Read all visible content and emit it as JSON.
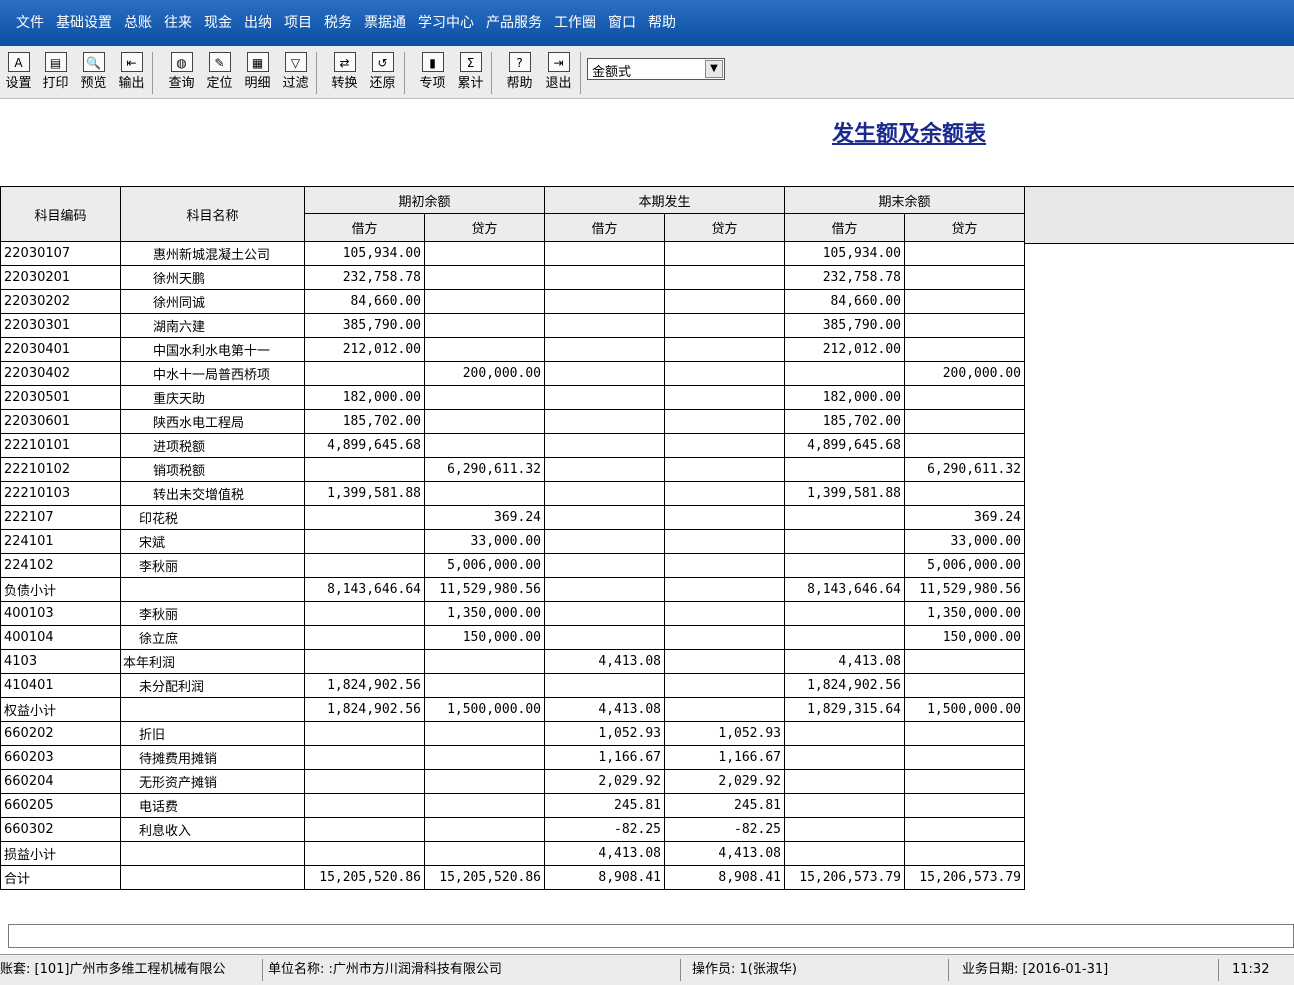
{
  "menu": [
    "文件",
    "基础设置",
    "总账",
    "往来",
    "现金",
    "出纳",
    "项目",
    "税务",
    "票据通",
    "学习中心",
    "产品服务",
    "工作圈",
    "窗口",
    "帮助"
  ],
  "toolbar": {
    "buttons": [
      {
        "label": "设置",
        "icon": "setup-icon",
        "glyph": "A"
      },
      {
        "label": "打印",
        "icon": "printer-icon",
        "glyph": "▤"
      },
      {
        "label": "预览",
        "icon": "preview-icon",
        "glyph": "🔍"
      },
      {
        "label": "输出",
        "icon": "export-icon",
        "glyph": "⇤"
      },
      {
        "label": "查询",
        "icon": "binoculars-icon",
        "glyph": "◍"
      },
      {
        "label": "定位",
        "icon": "locate-icon",
        "glyph": "✎"
      },
      {
        "label": "明细",
        "icon": "detail-icon",
        "glyph": "▦"
      },
      {
        "label": "过滤",
        "icon": "filter-icon",
        "glyph": "▽"
      },
      {
        "label": "转换",
        "icon": "convert-icon",
        "glyph": "⇄"
      },
      {
        "label": "还原",
        "icon": "restore-icon",
        "glyph": "↺"
      },
      {
        "label": "专项",
        "icon": "special-icon",
        "glyph": "▮"
      },
      {
        "label": "累计",
        "icon": "sigma-icon",
        "glyph": "Σ"
      },
      {
        "label": "帮助",
        "icon": "help-icon",
        "glyph": "?"
      },
      {
        "label": "退出",
        "icon": "exit-icon",
        "glyph": "⇥"
      }
    ],
    "format_select": "金额式"
  },
  "report": {
    "title": "发生额及余额表",
    "headers": {
      "code": "科目编码",
      "name": "科目名称",
      "opening": "期初余额",
      "current": "本期发生",
      "closing": "期末余额",
      "debit": "借方",
      "credit": "贷方"
    },
    "rows": [
      {
        "code": "22030107",
        "name": "惠州新城混凝土公司",
        "lvl": "l3",
        "od": "105,934.00",
        "oc": "",
        "cd": "",
        "cc": "",
        "ed": "105,934.00",
        "ec": ""
      },
      {
        "code": "22030201",
        "name": "徐州天鹏",
        "lvl": "l3",
        "od": "232,758.78",
        "oc": "",
        "cd": "",
        "cc": "",
        "ed": "232,758.78",
        "ec": ""
      },
      {
        "code": "22030202",
        "name": "徐州同诚",
        "lvl": "l3",
        "od": "84,660.00",
        "oc": "",
        "cd": "",
        "cc": "",
        "ed": "84,660.00",
        "ec": ""
      },
      {
        "code": "22030301",
        "name": "湖南六建",
        "lvl": "l3",
        "od": "385,790.00",
        "oc": "",
        "cd": "",
        "cc": "",
        "ed": "385,790.00",
        "ec": ""
      },
      {
        "code": "22030401",
        "name": "中国水利水电第十一",
        "lvl": "l3",
        "od": "212,012.00",
        "oc": "",
        "cd": "",
        "cc": "",
        "ed": "212,012.00",
        "ec": ""
      },
      {
        "code": "22030402",
        "name": "中水十一局普西桥项",
        "lvl": "l3",
        "od": "",
        "oc": "200,000.00",
        "cd": "",
        "cc": "",
        "ed": "",
        "ec": "200,000.00"
      },
      {
        "code": "22030501",
        "name": "重庆天助",
        "lvl": "l3",
        "od": "182,000.00",
        "oc": "",
        "cd": "",
        "cc": "",
        "ed": "182,000.00",
        "ec": ""
      },
      {
        "code": "22030601",
        "name": "陕西水电工程局",
        "lvl": "l3",
        "od": "185,702.00",
        "oc": "",
        "cd": "",
        "cc": "",
        "ed": "185,702.00",
        "ec": ""
      },
      {
        "code": "22210101",
        "name": "进项税额",
        "lvl": "l3",
        "od": "4,899,645.68",
        "oc": "",
        "cd": "",
        "cc": "",
        "ed": "4,899,645.68",
        "ec": ""
      },
      {
        "code": "22210102",
        "name": "销项税额",
        "lvl": "l3",
        "od": "",
        "oc": "6,290,611.32",
        "cd": "",
        "cc": "",
        "ed": "",
        "ec": "6,290,611.32"
      },
      {
        "code": "22210103",
        "name": "转出未交增值税",
        "lvl": "l3",
        "od": "1,399,581.88",
        "oc": "",
        "cd": "",
        "cc": "",
        "ed": "1,399,581.88",
        "ec": ""
      },
      {
        "code": "222107",
        "name": "印花税",
        "lvl": "l2",
        "od": "",
        "oc": "369.24",
        "cd": "",
        "cc": "",
        "ed": "",
        "ec": "369.24"
      },
      {
        "code": "224101",
        "name": "宋斌",
        "lvl": "l2",
        "od": "",
        "oc": "33,000.00",
        "cd": "",
        "cc": "",
        "ed": "",
        "ec": "33,000.00"
      },
      {
        "code": "224102",
        "name": "李秋丽",
        "lvl": "l2",
        "od": "",
        "oc": "5,006,000.00",
        "cd": "",
        "cc": "",
        "ed": "",
        "ec": "5,006,000.00"
      },
      {
        "code": "负债小计",
        "name": "",
        "lvl": "l1",
        "od": "8,143,646.64",
        "oc": "11,529,980.56",
        "cd": "",
        "cc": "",
        "ed": "8,143,646.64",
        "ec": "11,529,980.56"
      },
      {
        "code": "400103",
        "name": "李秋丽",
        "lvl": "l2",
        "od": "",
        "oc": "1,350,000.00",
        "cd": "",
        "cc": "",
        "ed": "",
        "ec": "1,350,000.00"
      },
      {
        "code": "400104",
        "name": "徐立庶",
        "lvl": "l2",
        "od": "",
        "oc": "150,000.00",
        "cd": "",
        "cc": "",
        "ed": "",
        "ec": "150,000.00"
      },
      {
        "code": "4103",
        "name": "本年利润",
        "lvl": "l1",
        "od": "",
        "oc": "",
        "cd": "4,413.08",
        "cc": "",
        "ed": "4,413.08",
        "ec": ""
      },
      {
        "code": "410401",
        "name": "未分配利润",
        "lvl": "l2",
        "od": "1,824,902.56",
        "oc": "",
        "cd": "",
        "cc": "",
        "ed": "1,824,902.56",
        "ec": ""
      },
      {
        "code": "权益小计",
        "name": "",
        "lvl": "l1",
        "od": "1,824,902.56",
        "oc": "1,500,000.00",
        "cd": "4,413.08",
        "cc": "",
        "ed": "1,829,315.64",
        "ec": "1,500,000.00"
      },
      {
        "code": "660202",
        "name": "折旧",
        "lvl": "l2",
        "od": "",
        "oc": "",
        "cd": "1,052.93",
        "cc": "1,052.93",
        "ed": "",
        "ec": ""
      },
      {
        "code": "660203",
        "name": "待摊费用摊销",
        "lvl": "l2",
        "od": "",
        "oc": "",
        "cd": "1,166.67",
        "cc": "1,166.67",
        "ed": "",
        "ec": ""
      },
      {
        "code": "660204",
        "name": "无形资产摊销",
        "lvl": "l2",
        "od": "",
        "oc": "",
        "cd": "2,029.92",
        "cc": "2,029.92",
        "ed": "",
        "ec": ""
      },
      {
        "code": "660205",
        "name": "电话费",
        "lvl": "l2",
        "od": "",
        "oc": "",
        "cd": "245.81",
        "cc": "245.81",
        "ed": "",
        "ec": ""
      },
      {
        "code": "660302",
        "name": "利息收入",
        "lvl": "l2",
        "od": "",
        "oc": "",
        "cd": "-82.25",
        "cc": "-82.25",
        "ed": "",
        "ec": ""
      },
      {
        "code": "损益小计",
        "name": "",
        "lvl": "l1",
        "od": "",
        "oc": "",
        "cd": "4,413.08",
        "cc": "4,413.08",
        "ed": "",
        "ec": ""
      },
      {
        "code": "合计",
        "name": "",
        "lvl": "l1",
        "od": "15,205,520.86",
        "oc": "15,205,520.86",
        "cd": "8,908.41",
        "cc": "8,908.41",
        "ed": "15,206,573.79",
        "ec": "15,206,573.79"
      }
    ]
  },
  "status": {
    "account_set": "账套: [101]广州市多维工程机械有限公",
    "unit": "单位名称: :广州市方川润滑科技有限公司",
    "operator": "操作员: 1(张淑华)",
    "biz_date": "业务日期: [2016-01-31]",
    "time": "11:32"
  }
}
